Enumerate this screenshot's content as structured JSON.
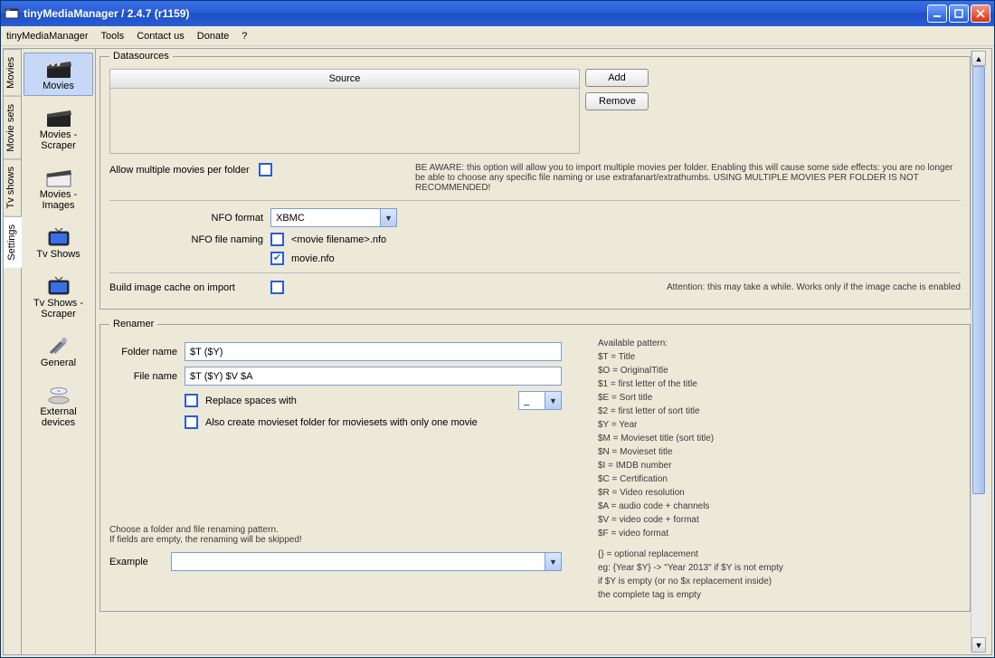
{
  "window": {
    "title": "tinyMediaManager / 2.4.7 (r1159)"
  },
  "menubar": [
    "tinyMediaManager",
    "Tools",
    "Contact us",
    "Donate",
    "?"
  ],
  "left_tabs": [
    "Movies",
    "Movie sets",
    "Tv shows",
    "Settings"
  ],
  "active_left_tab": "Settings",
  "sidenav": [
    {
      "label": "Movies",
      "icon": "clapper"
    },
    {
      "label": "Movies - Scraper",
      "icon": "clapper"
    },
    {
      "label": "Movies - Images",
      "icon": "clapper"
    },
    {
      "label": "Tv Shows",
      "icon": "tv"
    },
    {
      "label": "Tv Shows - Scraper",
      "icon": "tv"
    },
    {
      "label": "General",
      "icon": "tools"
    },
    {
      "label": "External devices",
      "icon": "disc"
    }
  ],
  "active_nav": 0,
  "datasources": {
    "legend": "Datasources",
    "source_header": "Source",
    "add": "Add",
    "remove": "Remove",
    "allow_label": "Allow multiple movies per folder",
    "allow_checked": false,
    "warning": "BE AWARE: this option will allow you to import multiple movies per folder. Enabling this will cause some side effects: you are no longer be able to choose any specific file naming or use extrafanart/extrathumbs. USING MULTIPLE MOVIES PER FOLDER IS NOT RECOMMENDED!",
    "nfo_format_label": "NFO format",
    "nfo_format_value": "XBMC",
    "nfo_filenaming_label": "NFO file naming",
    "nfo_opt1": {
      "label": "<movie filename>.nfo",
      "checked": false
    },
    "nfo_opt2": {
      "label": "movie.nfo",
      "checked": true
    },
    "cache_label": "Build image cache on import",
    "cache_checked": false,
    "cache_note": "Attention: this may take a while. Works only if the image cache is enabled"
  },
  "renamer": {
    "legend": "Renamer",
    "folder_label": "Folder name",
    "folder_value": "$T ($Y)",
    "file_label": "File name",
    "file_value": "$T ($Y) $V $A",
    "replace_label": "Replace spaces with",
    "replace_checked": false,
    "replace_value": "_",
    "also_create_label": "Also create movieset folder for moviesets with only one movie",
    "also_create_checked": false,
    "hint1": "Choose a folder and file renaming pattern.",
    "hint2": "If fields are empty, the renaming will be skipped!",
    "example_label": "Example",
    "example_value": "",
    "pattern_header": "Available pattern:",
    "patterns": [
      "$T = Title",
      "$O = OriginalTitle",
      "$1 = first letter of the title",
      "$E = Sort title",
      "$2 = first letter of sort title",
      "$Y = Year",
      "$M = Movieset title (sort title)",
      "$N = Movieset title",
      "$I = IMDB number",
      "$C = Certification",
      "$R = Video resolution",
      "$A = audio code + channels",
      "$V = video code + format",
      "$F = video format"
    ],
    "opt_hint1": "{} = optional replacement",
    "opt_hint2": "eg: {Year $Y} -> \"Year 2013\" if $Y is not empty",
    "opt_hint3": "if $Y is empty (or no $x replacement inside)",
    "opt_hint4": "the complete tag is empty"
  }
}
